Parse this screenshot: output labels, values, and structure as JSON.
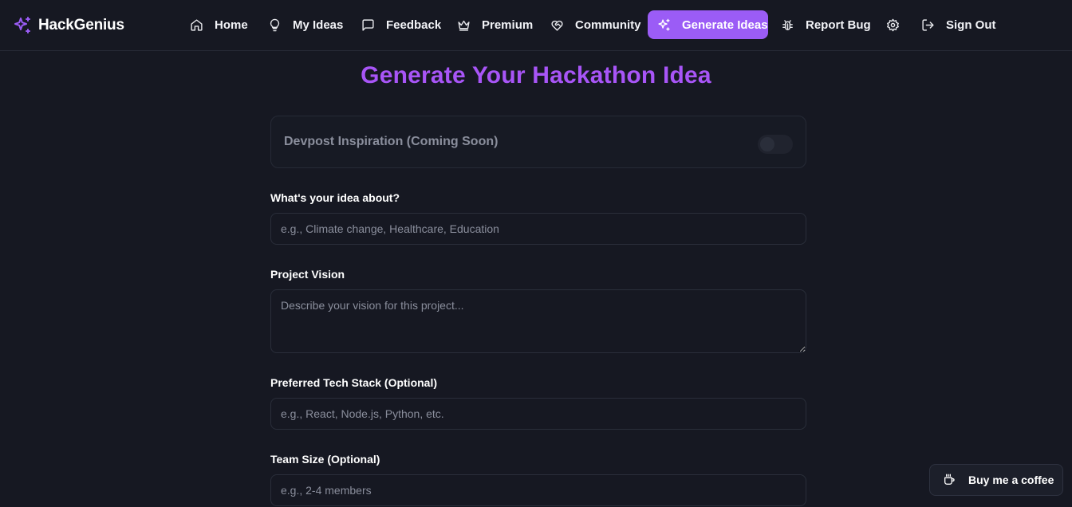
{
  "brand": {
    "name": "HackGenius",
    "icon": "sparkles-icon",
    "accent": "#9b5cf6"
  },
  "nav": {
    "items": [
      {
        "label": "Home",
        "icon": "home-icon"
      },
      {
        "label": "My Ideas",
        "icon": "lightbulb-icon"
      },
      {
        "label": "Feedback",
        "icon": "message-square-icon"
      },
      {
        "label": "Premium",
        "icon": "crown-icon"
      },
      {
        "label": "Community",
        "icon": "heart-handshake-icon"
      },
      {
        "label": "Generate Ideas",
        "icon": "sparkles-icon",
        "active": true
      },
      {
        "label": "Report Bug",
        "icon": "bug-icon"
      },
      {
        "label": "",
        "icon": "gear-icon"
      },
      {
        "label": "Sign Out",
        "icon": "log-out-icon"
      }
    ]
  },
  "page": {
    "title": "Generate Your Hackathon Idea",
    "title_color": "#a855f7"
  },
  "devpost": {
    "label": "Devpost Inspiration (Coming Soon)",
    "enabled": false
  },
  "form": {
    "topic": {
      "label": "What's your idea about?",
      "placeholder": "e.g., Climate change, Healthcare, Education",
      "value": ""
    },
    "vision": {
      "label": "Project Vision",
      "placeholder": "Describe your vision for this project...",
      "value": ""
    },
    "tech_stack": {
      "label": "Preferred Tech Stack (Optional)",
      "placeholder": "e.g., React, Node.js, Python, etc.",
      "value": ""
    },
    "team_size": {
      "label": "Team Size (Optional)",
      "placeholder": "e.g., 2-4 members",
      "value": ""
    }
  },
  "coffee": {
    "label": "Buy me a coffee",
    "icon": "coffee-cup-icon"
  }
}
